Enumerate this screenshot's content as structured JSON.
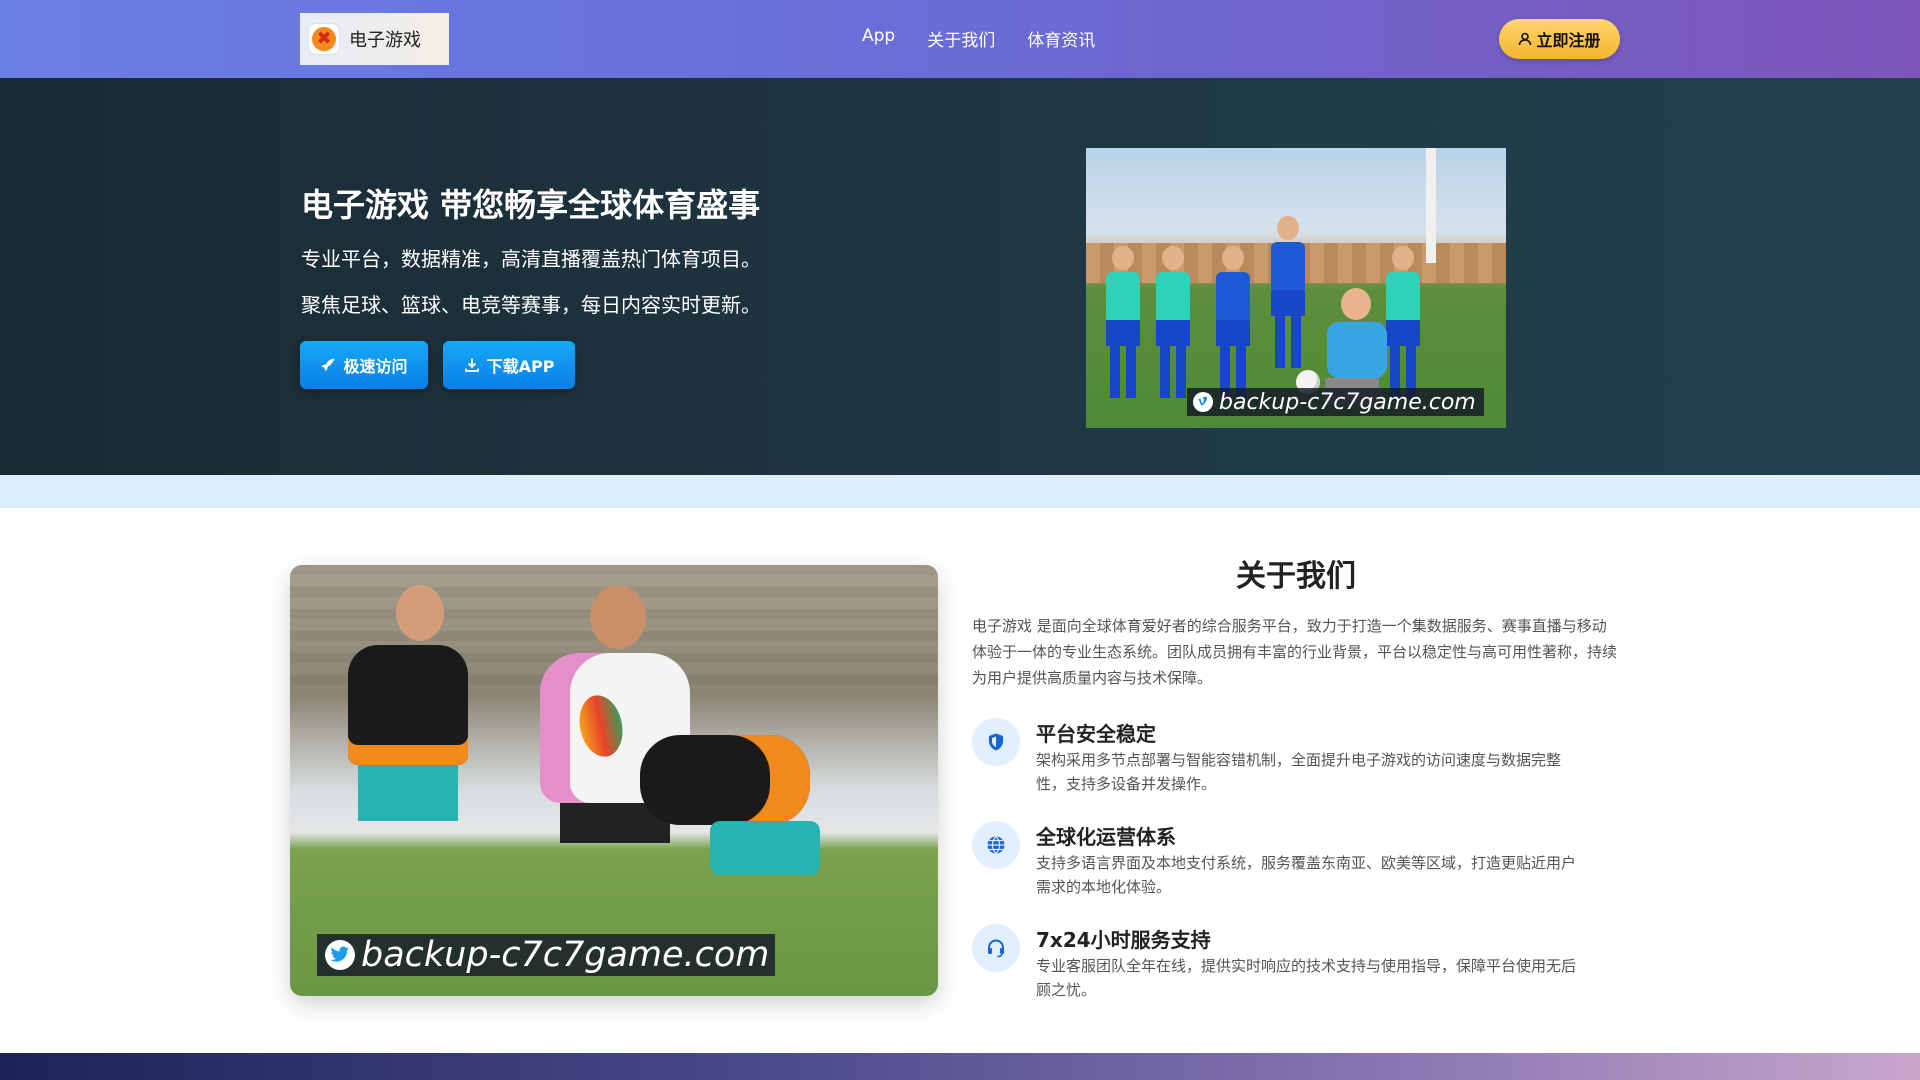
{
  "navbar": {
    "brand_name": "电子游戏",
    "links": [
      "App",
      "关于我们",
      "体育资讯"
    ],
    "register_label": "立即注册",
    "gradient": [
      "#6a7fe6",
      "#7d55b8"
    ]
  },
  "hero": {
    "title": "电子游戏 带您畅享全球体育盛事",
    "line1": "专业平台，数据精准，高清直播覆盖热门体育项目。",
    "line2": "聚焦足球、篮球、电竞等赛事，每日内容实时更新。",
    "visit_label": "极速访问",
    "download_label": "下载APP",
    "photo_watermark": "backup-c7c7game.com",
    "photo_watermark_icon": "vimeo-icon"
  },
  "about": {
    "title": "关于我们",
    "description": "电子游戏 是面向全球体育爱好者的综合服务平台，致力于打造一个集数据服务、赛事直播与移动体验于一体的专业生态系统。团队成员拥有丰富的行业背景，平台以稳定性与高可用性著称，持续为用户提供高质量内容与技术保障。",
    "photo_watermark": "backup-c7c7game.com",
    "photo_watermark_icon": "twitter-icon",
    "features": [
      {
        "icon": "shield-icon",
        "title": "平台安全稳定",
        "desc": "架构采用多节点部署与智能容错机制，全面提升电子游戏的访问速度与数据完整性，支持多设备并发操作。"
      },
      {
        "icon": "globe-icon",
        "title": "全球化运营体系",
        "desc": "支持多语言界面及本地支付系统，服务覆盖东南亚、欧美等区域，打造更贴近用户需求的本地化体验。"
      },
      {
        "icon": "headset-icon",
        "title": "7x24小时服务支持",
        "desc": "专业客服团队全年在线，提供实时响应的技术支持与使用指导，保障平台使用无后顾之忧。"
      }
    ]
  },
  "colors": {
    "accent_blue": "#0a7ee8",
    "register_yellow": "#f5b52c",
    "hero_bg": "#1f3541",
    "icon_bg": "#e1efff"
  }
}
